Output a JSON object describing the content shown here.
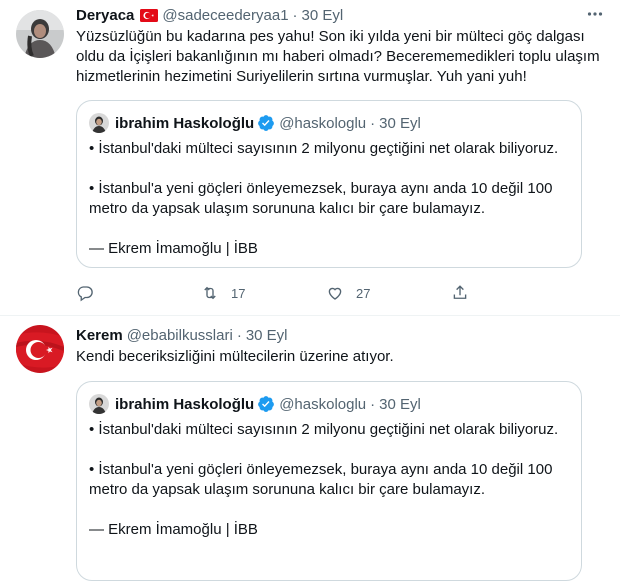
{
  "quote": {
    "author_name": "ibrahim Haskoloğlu",
    "handle": "@haskologlu",
    "date": "30 Eyl",
    "para1": "• İstanbul'daki mülteci sayısının 2 milyonu geçtiğini net olarak biliyoruz.",
    "para2": "• İstanbul'a yeni göçleri önleyemezsek, buraya aynı anda 10 değil 100 metro da yapsak ulaşım sorununa kalıcı bir çare bulamayız.",
    "para3": "— Ekrem İmamoğlu | İBB"
  },
  "tweets": [
    {
      "author_name": "Deryaca",
      "flag": "turkey-flag-emoji",
      "handle": "@sadeceederyaa1",
      "separator": "·",
      "date": "30 Eyl",
      "text": "Yüzsüzlüğün bu kadarına pes yahu! Son iki yılda yeni bir mülteci göç dalgası oldu da İçişleri bakanlığının mı haberi olmadı? Becerememedikleri toplu ulaşım hizmetlerinin hezimetini Suriyelilerin sırtına vurmuşlar. Yuh yani yuh!",
      "reply_count": "",
      "retweet_count": "17",
      "like_count": "27"
    },
    {
      "author_name": "Kerem",
      "handle": "@ebabilkusslari",
      "separator": "·",
      "date": "30 Eyl",
      "text": "Kendi beceriksizliğini mültecilerin üzerine atıyor."
    }
  ],
  "colors": {
    "text": "#0f1419",
    "secondary": "#536471",
    "border": "#cfd9de",
    "verified": "#1d9bf0",
    "flag_red": "#e30a17"
  }
}
